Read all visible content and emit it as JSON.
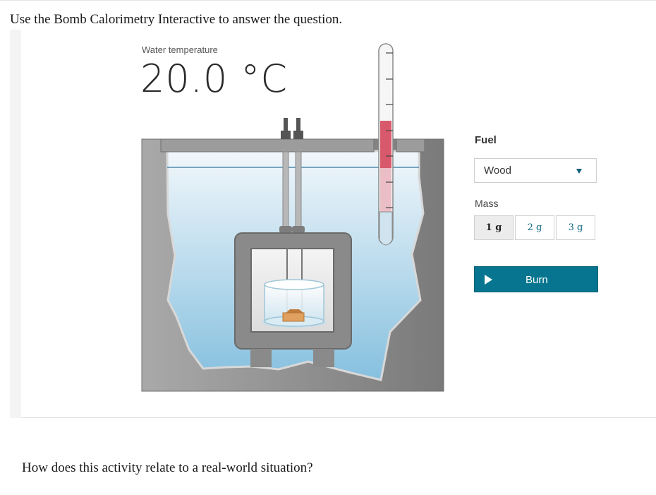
{
  "instruction": "Use the Bomb Calorimetry Interactive to answer the question.",
  "calorimeter": {
    "temperature_label": "Water temperature",
    "temperature_value": "20.0 °C",
    "thermometer_fill_fraction": 0.33
  },
  "controls": {
    "fuel_label": "Fuel",
    "fuel_selected": "Wood",
    "mass_label": "Mass",
    "mass_options": [
      "1 g",
      "2 g",
      "3 g"
    ],
    "mass_selected": "1 g",
    "burn_label": "Burn"
  },
  "question": "How does this activity relate to a real-world situation?",
  "colors": {
    "accent": "#07758f",
    "water_top": "#eef6fb",
    "water_bottom": "#8ec4e2",
    "mercury": "#d9596c",
    "fuel": "#e0a060"
  }
}
